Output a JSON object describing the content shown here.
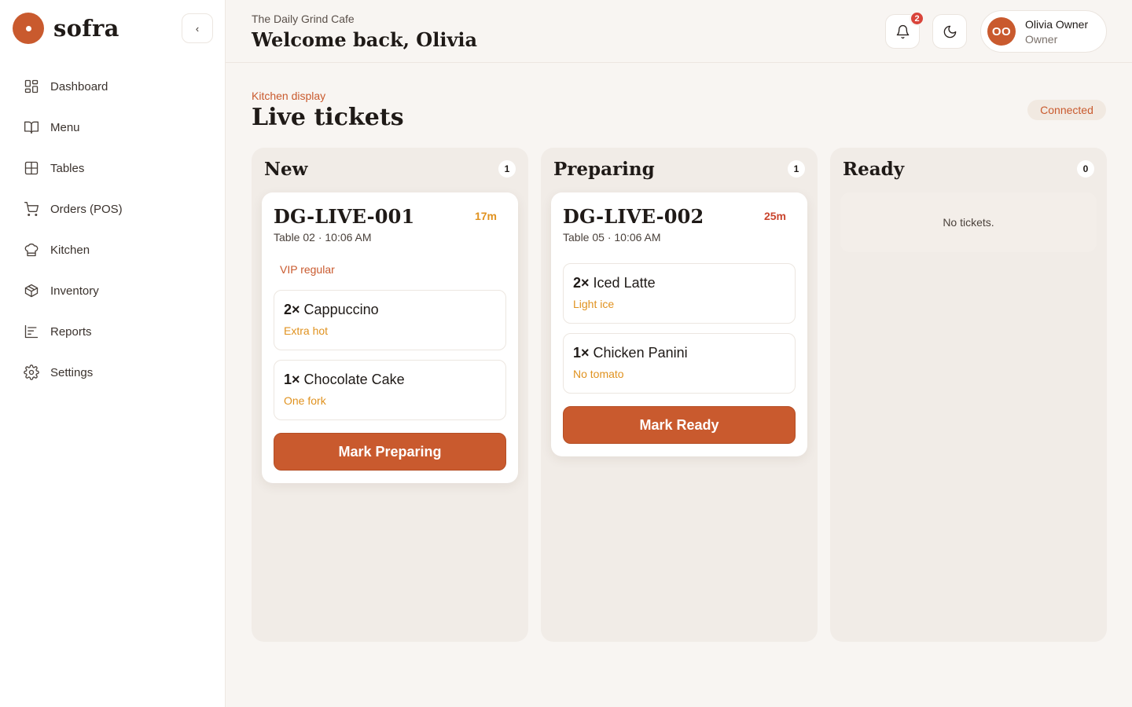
{
  "brand": {
    "name": "sofra",
    "collapse_glyph": "‹"
  },
  "nav": {
    "items": [
      {
        "label": "Dashboard",
        "icon": "grid-icon"
      },
      {
        "label": "Menu",
        "icon": "book-icon"
      },
      {
        "label": "Tables",
        "icon": "table-icon"
      },
      {
        "label": "Orders (POS)",
        "icon": "cart-icon"
      },
      {
        "label": "Kitchen",
        "icon": "chef-hat-icon"
      },
      {
        "label": "Inventory",
        "icon": "box-icon"
      },
      {
        "label": "Reports",
        "icon": "bar-chart-icon"
      },
      {
        "label": "Settings",
        "icon": "gear-icon"
      }
    ]
  },
  "header": {
    "cafe_name": "The Daily Grind Cafe",
    "welcome": "Welcome back, Olivia",
    "notifications_count": "2",
    "user": {
      "initials": "OO",
      "name": "Olivia Owner",
      "role": "Owner"
    }
  },
  "page": {
    "eyebrow": "Kitchen display",
    "title": "Live tickets",
    "connection_status": "Connected"
  },
  "columns": {
    "new": {
      "title": "New",
      "count": "1",
      "ticket": {
        "id": "DG-LIVE-001",
        "age": "17m",
        "meta": "Table 02 · 10:06 AM",
        "note": "VIP regular",
        "items": [
          {
            "qty": "2×",
            "name": "Cappuccino",
            "mod": "Extra hot"
          },
          {
            "qty": "1×",
            "name": "Chocolate Cake",
            "mod": "One fork"
          }
        ],
        "action": "Mark Preparing"
      }
    },
    "preparing": {
      "title": "Preparing",
      "count": "1",
      "ticket": {
        "id": "DG-LIVE-002",
        "age": "25m",
        "meta": "Table 05 · 10:06 AM",
        "items": [
          {
            "qty": "2×",
            "name": "Iced Latte",
            "mod": "Light ice"
          },
          {
            "qty": "1×",
            "name": "Chicken Panini",
            "mod": "No tomato"
          }
        ],
        "action": "Mark Ready"
      }
    },
    "ready": {
      "title": "Ready",
      "count": "0",
      "empty": "No tickets."
    }
  },
  "colors": {
    "accent": "#c95a2e",
    "warning": "#e0921f",
    "late": "#c9452e",
    "badge": "#d9443a"
  }
}
